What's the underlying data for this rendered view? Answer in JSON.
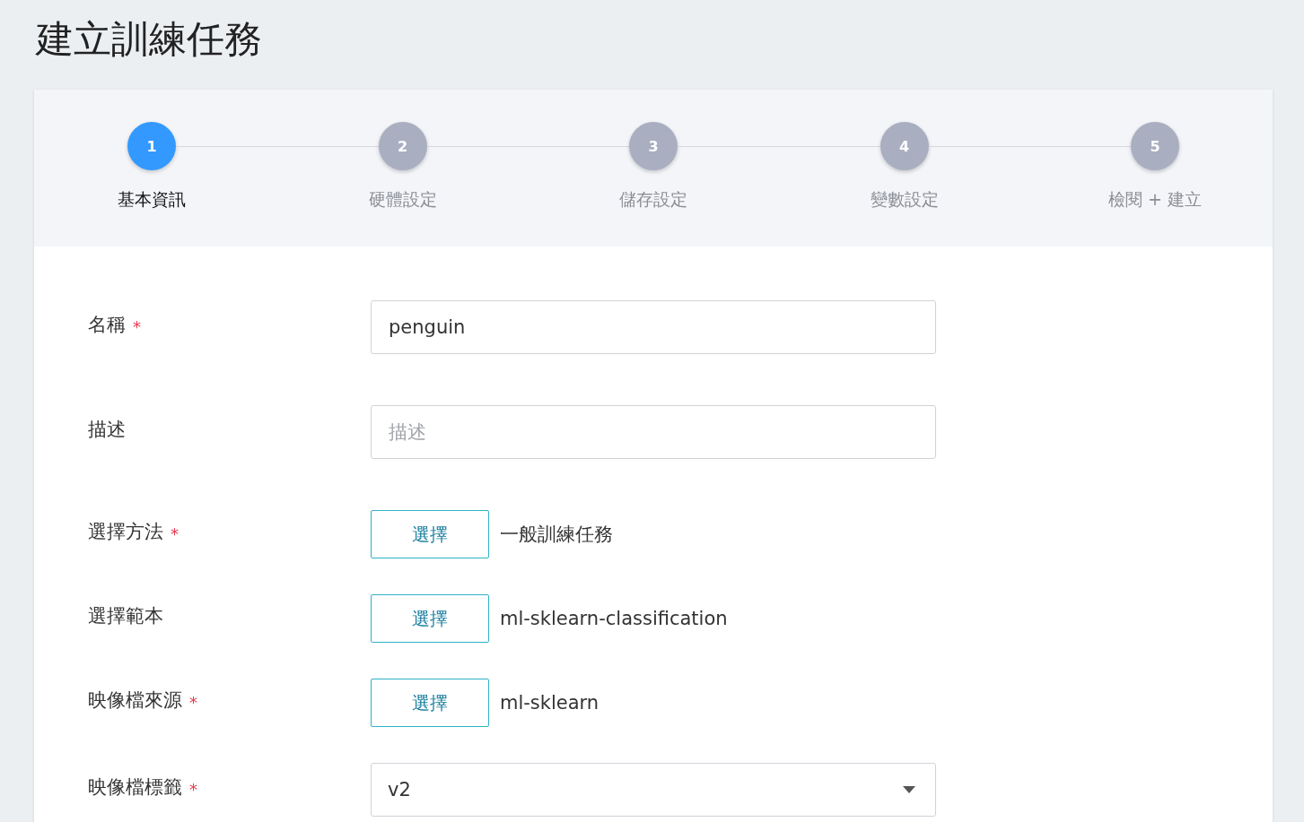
{
  "title": "建立訓練任務",
  "steps": [
    {
      "number": "1",
      "label": "基本資訊",
      "selected": true
    },
    {
      "number": "2",
      "label": "硬體設定",
      "selected": false
    },
    {
      "number": "3",
      "label": "儲存設定",
      "selected": false
    },
    {
      "number": "4",
      "label": "變數設定",
      "selected": false
    },
    {
      "number": "5",
      "label": "檢閱 + 建立",
      "selected": false
    }
  ],
  "fields": [
    {
      "kind": "text",
      "label": "名稱",
      "required_mark": "*",
      "value": "penguin"
    },
    {
      "kind": "text",
      "label": "描述",
      "placeholder": "描述"
    },
    {
      "kind": "picker",
      "label": "選擇方法",
      "required_mark": "*",
      "button": "選擇",
      "value": "一般訓練任務"
    },
    {
      "kind": "picker",
      "label": "選擇範本",
      "button": "選擇",
      "value": "ml-sklearn-classification"
    },
    {
      "kind": "picker",
      "label": "映像檔來源",
      "required_mark": "*",
      "button": "選擇",
      "value": "ml-sklearn"
    },
    {
      "kind": "select",
      "label": "映像檔標籤",
      "required_mark": "*",
      "value": "v2"
    }
  ]
}
